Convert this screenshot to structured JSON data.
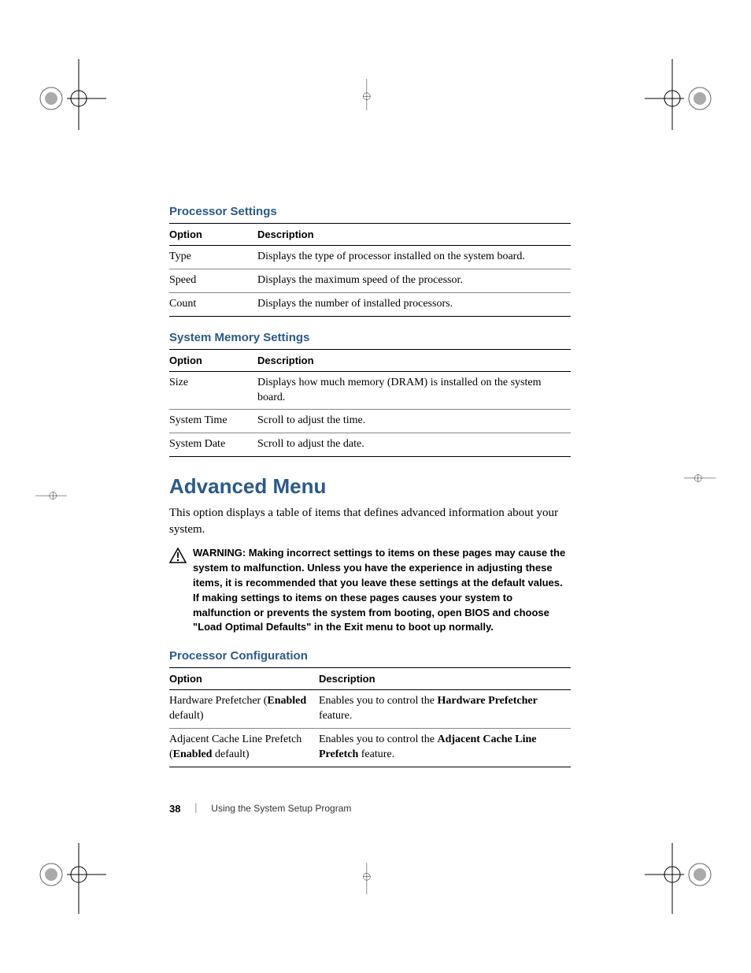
{
  "section1": {
    "heading": "Processor Settings",
    "headers": {
      "option": "Option",
      "description": "Description"
    },
    "rows": [
      {
        "option": "Type",
        "desc": "Displays the type of processor installed on the system board."
      },
      {
        "option": "Speed",
        "desc": "Displays the maximum speed of the processor."
      },
      {
        "option": "Count",
        "desc": "Displays the number of installed processors."
      }
    ]
  },
  "section2": {
    "heading": "System Memory Settings",
    "headers": {
      "option": "Option",
      "description": "Description"
    },
    "rows": [
      {
        "option": "Size",
        "desc": "Displays how much memory (DRAM) is installed on the system board."
      },
      {
        "option": "System Time",
        "desc": "Scroll to adjust the time."
      },
      {
        "option": "System Date",
        "desc": "Scroll to adjust the date."
      }
    ]
  },
  "advanced": {
    "heading": "Advanced Menu",
    "intro": "This option displays a table of items that defines advanced information about your system.",
    "warning_label": "WARNING: ",
    "warning_body": "Making incorrect settings to items on these pages may cause the system to malfunction. Unless you have the experience in adjusting these items, it is recommended that you leave these settings at the default values. If making settings to items on these pages causes your system to malfunction or prevents the system from booting, open BIOS and choose \"Load Optimal Defaults\" in the Exit menu to boot up normally."
  },
  "section3": {
    "heading": "Processor Configuration",
    "headers": {
      "option": "Option",
      "description": "Description"
    },
    "rows": [
      {
        "option_pre": "Hardware Prefetcher (",
        "option_bold": "Enabled",
        "option_post": " default)",
        "desc_pre": "Enables you to control the ",
        "desc_bold": "Hardware Prefetcher",
        "desc_post": " feature."
      },
      {
        "option_pre": "Adjacent Cache Line Prefetch (",
        "option_bold": "Enabled",
        "option_post": " default)",
        "desc_pre": "Enables you to control the ",
        "desc_bold": "Adjacent Cache Line Prefetch",
        "desc_post": " feature."
      }
    ]
  },
  "footer": {
    "page": "38",
    "chapter": "Using the System Setup Program"
  }
}
